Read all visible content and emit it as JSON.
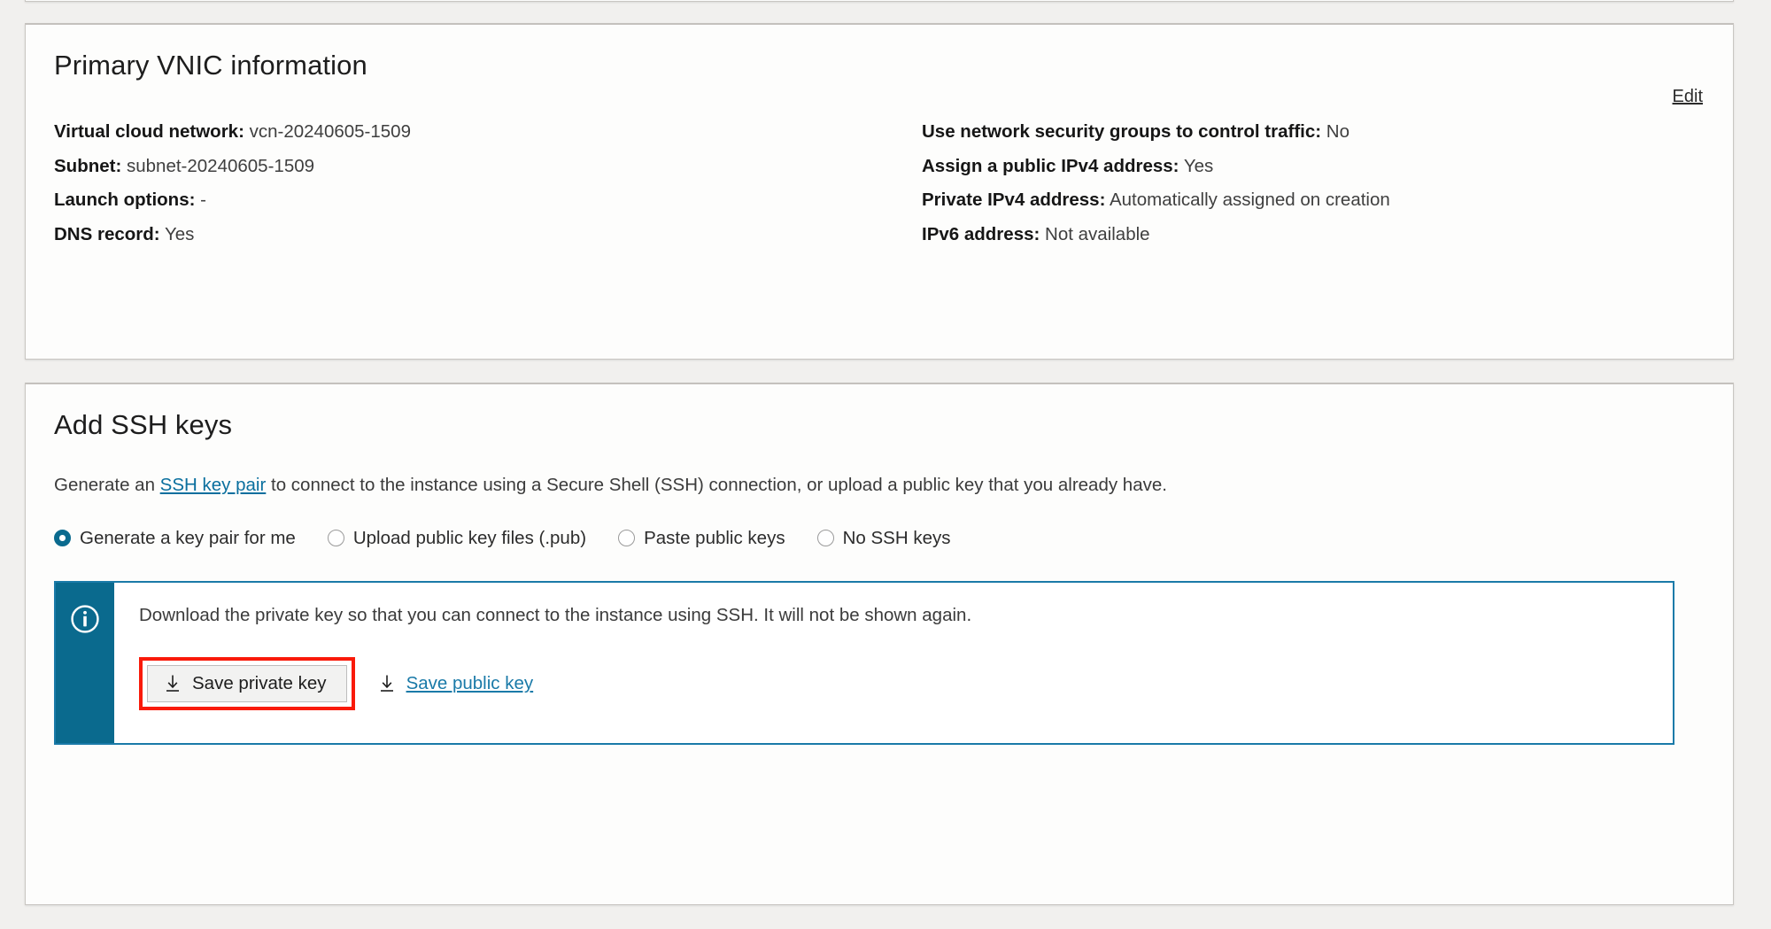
{
  "colors": {
    "page_background": "#f1f0ee",
    "card_background": "#fdfdfc",
    "accent_teal": "#0a6a8e",
    "link_blue": "#1a7aa8",
    "highlight_red": "#f91a09"
  },
  "vnic_card": {
    "title": "Primary VNIC information",
    "edit_label": "Edit",
    "left_column": [
      {
        "key": "Virtual cloud network:",
        "value": "vcn-20240605-1509"
      },
      {
        "key": "Subnet:",
        "value": "subnet-20240605-1509"
      },
      {
        "key": "Launch options:",
        "value": "-"
      },
      {
        "key": "DNS record:",
        "value": "Yes"
      }
    ],
    "right_column": [
      {
        "key": "Use network security groups to control traffic:",
        "value": "No"
      },
      {
        "key": "Assign a public IPv4 address:",
        "value": "Yes"
      },
      {
        "key": "Private IPv4 address:",
        "value": "Automatically assigned on creation"
      },
      {
        "key": "IPv6 address:",
        "value": "Not available"
      }
    ]
  },
  "ssh_card": {
    "title": "Add SSH keys",
    "description_before_link": "Generate an ",
    "description_link": "SSH key pair",
    "description_after_link": " to connect to the instance using a Secure Shell (SSH) connection, or upload a public key that you already have.",
    "radio_options": [
      {
        "label": "Generate a key pair for me",
        "selected": true
      },
      {
        "label": "Upload public key files (.pub)",
        "selected": false
      },
      {
        "label": "Paste public keys",
        "selected": false
      },
      {
        "label": "No SSH keys",
        "selected": false
      }
    ],
    "info_banner": {
      "icon": "info-circle-icon",
      "text": "Download the private key so that you can connect to the instance using SSH. It will not be shown again.",
      "save_private_key_label": "Save private key",
      "save_public_key_label": "Save public key",
      "download_icon": "download-arrow-icon"
    }
  }
}
